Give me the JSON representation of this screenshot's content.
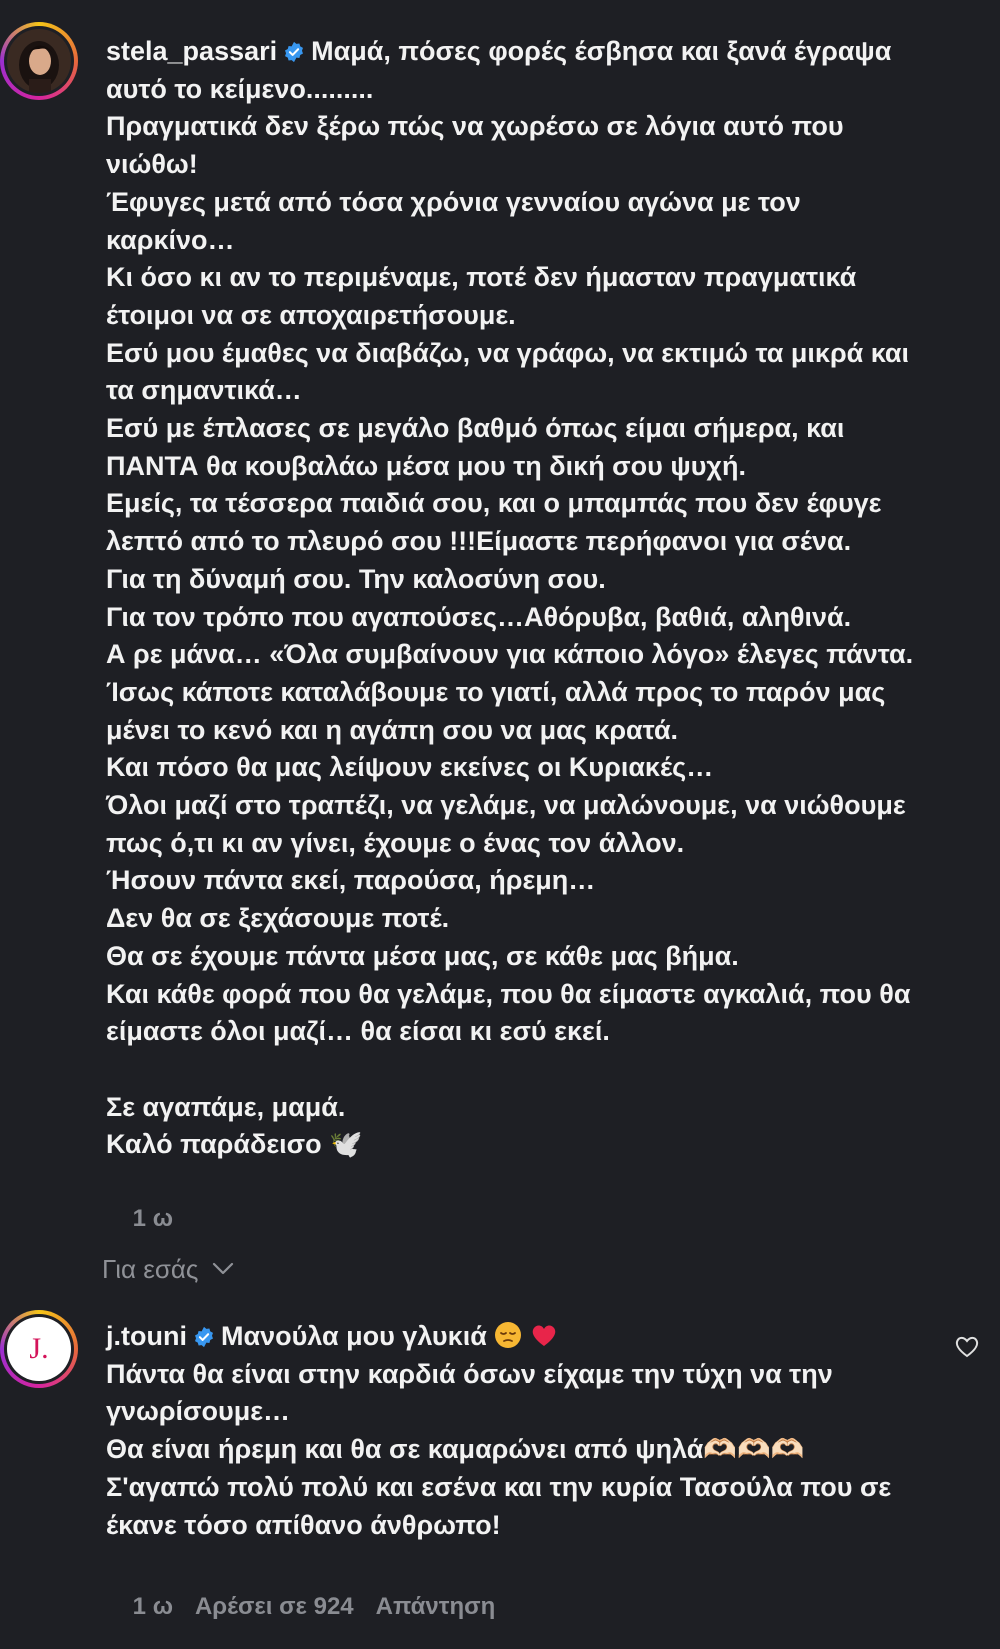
{
  "comments": [
    {
      "username": "stela_passari",
      "lines": [
        "Μαμά, πόσες φορές έσβησα και ξανά έγραψα",
        "αυτό το κείμενο.........",
        "Πραγματικά δεν ξέρω πώς να χωρέσω σε λόγια αυτό που",
        "νιώθω!",
        "Έφυγες μετά από τόσα χρόνια γενναίου αγώνα με τον",
        "καρκίνο…",
        "Κι όσο κι αν το περιμέναμε, ποτέ δεν ήμασταν πραγματικά",
        "έτοιμοι να σε αποχαιρετήσουμε.",
        "Εσύ μου έμαθες να διαβάζω, να γράφω, να εκτιμώ τα μικρά και",
        "τα σημαντικά…",
        "Εσύ με έπλασες σε μεγάλο βαθμό όπως είμαι σήμερα, και",
        "ΠΑΝΤΑ θα κουβαλάω μέσα μου τη δική σου ψυχή.",
        "Εμείς, τα τέσσερα παιδιά σου, και ο μπαμπάς που δεν έφυγε",
        "λεπτό από το πλευρό σου !!!Είμαστε περήφανοι για σένα.",
        "Για τη δύναμή σου. Την καλοσύνη σου.",
        "Για τον τρόπο που αγαπούσες…Αθόρυβα, βαθιά, αληθινά.",
        "Α ρε μάνα… «Όλα συμβαίνουν για κάποιο λόγο» έλεγες πάντα.",
        "Ίσως κάποτε καταλάβουμε το γιατί, αλλά προς το παρόν μας",
        "μένει το κενό και η αγάπη σου να μας κρατά.",
        "Και πόσο θα μας λείψουν εκείνες οι Κυριακές…",
        "Όλοι μαζί στο τραπέζι, να γελάμε, να μαλώνουμε, να νιώθουμε",
        "πως ό,τι κι αν γίνει, έχουμε ο ένας τον άλλον.",
        "Ήσουν πάντα εκεί, παρούσα, ήρεμη…",
        "Δεν θα σε ξεχάσουμε ποτέ.",
        "Θα σε έχουμε πάντα μέσα μας, σε κάθε μας βήμα.",
        "Και κάθε φορά που θα γελάμε, που θα είμαστε αγκαλιά, που θα",
        "είμαστε όλοι μαζί… θα είσαι κι εσύ εκεί.",
        "",
        "Σε αγαπάμε, μαμά.",
        "Καλό παράδεισο 🕊️"
      ],
      "time": "1 ω"
    },
    {
      "username": "j.touni",
      "avatar_letter": "J.",
      "first_line": "Μανούλα μου γλυκιά",
      "lines": [
        "Πάντα θα είναι στην καρδιά όσων είχαμε την τύχη να την",
        "γνωρίσουμε…",
        "Θα είναι ήρεμη και θα σε καμαρώνει από ψηλά🫶🏻🫶🏻🫶🏻",
        "Σ'αγαπώ πολύ πολύ και εσένα και την κυρία Τασούλα που σε",
        "έκανε τόσο απίθανο άνθρωπο!"
      ],
      "time": "1 ω",
      "likes": "Αρέσει σε 924",
      "reply": "Απάντηση"
    }
  ],
  "for_you_label": "Για εσάς",
  "icons": {
    "verified": "verified-badge-icon",
    "chevron": "chevron-down-icon",
    "heart_like": "heart-outline-icon",
    "pensive": "pensive-face-emoji",
    "red_heart": "red-heart-emoji"
  },
  "colors": {
    "background": "#1e1f24",
    "text": "#f2f2f2",
    "muted": "#8a8c92",
    "verified": "#3897f0",
    "heart": "#e8254a"
  }
}
